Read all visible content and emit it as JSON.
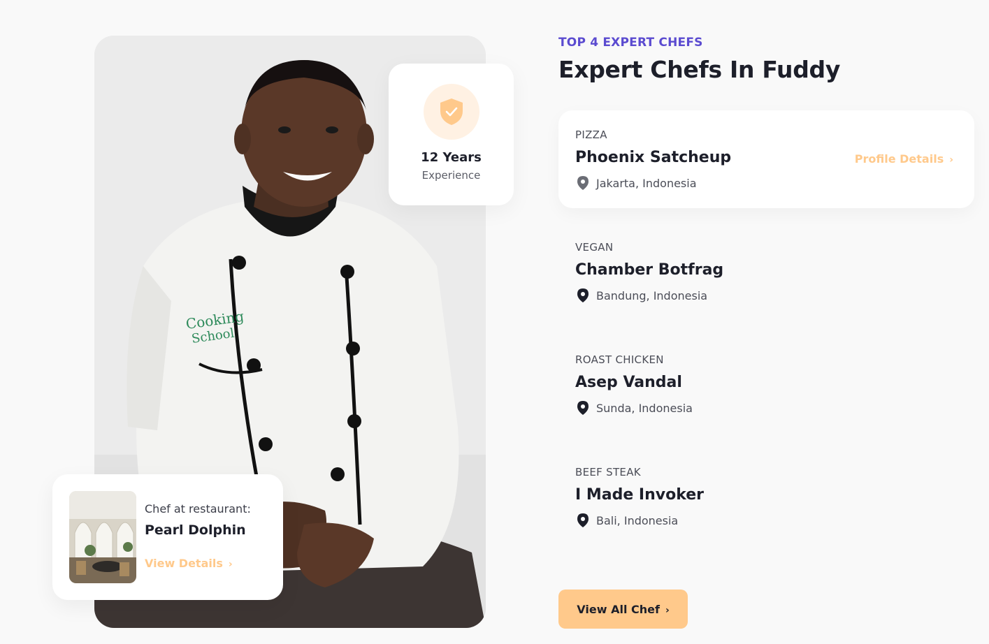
{
  "section": {
    "eyebrow": "TOP 4 EXPERT CHEFS",
    "title": "Expert Chefs In Fuddy"
  },
  "experience": {
    "years": "12 Years",
    "label": "Experience",
    "icon": "shield-check-icon"
  },
  "restaurant": {
    "label": "Chef at restaurant:",
    "name": "Pearl Dolphin",
    "link": "View Details"
  },
  "chefs": [
    {
      "category": "PIZZA",
      "name": "Phoenix Satcheup",
      "location": "Jakarta, Indonesia",
      "link": "Profile Details"
    },
    {
      "category": "VEGAN",
      "name": "Chamber Botfrag",
      "location": "Bandung, Indonesia"
    },
    {
      "category": "ROAST CHICKEN",
      "name": "Asep Vandal",
      "location": "Sunda, Indonesia"
    },
    {
      "category": "BEEF STEAK",
      "name": "I Made Invoker",
      "location": "Bali, Indonesia"
    }
  ],
  "view_all": "View All Chef",
  "colors": {
    "accent": "#ffc98b",
    "eyebrow": "#5b4bd0",
    "text": "#1d1f2a",
    "background": "#f9f9f9"
  }
}
